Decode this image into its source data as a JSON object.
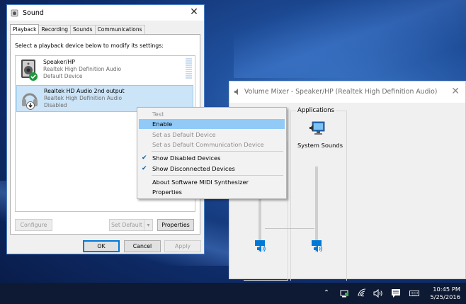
{
  "sound_dialog": {
    "title": "Sound",
    "tabs": [
      "Playback",
      "Recording",
      "Sounds",
      "Communications"
    ],
    "active_tab": "Playback",
    "instructions": "Select a playback device below to modify its settings:",
    "devices": [
      {
        "name": "Speaker/HP",
        "driver": "Realtek High Definition Audio",
        "status": "Default Device",
        "icon": "speaker-icon",
        "badge": "default-check-icon"
      },
      {
        "name": "Realtek HD Audio 2nd output",
        "driver": "Realtek High Definition Audio",
        "status": "Disabled",
        "icon": "headphones-icon",
        "badge": "disabled-arrow-icon"
      }
    ],
    "buttons": {
      "configure": "Configure",
      "set_default": "Set Default",
      "properties": "Properties",
      "ok": "OK",
      "cancel": "Cancel",
      "apply": "Apply"
    }
  },
  "context_menu": {
    "items": [
      {
        "label": "Test",
        "enabled": false
      },
      {
        "label": "Enable",
        "enabled": true,
        "highlighted": true
      },
      {
        "label": "Set as Default Device",
        "enabled": false
      },
      {
        "label": "Set as Default Communication Device",
        "enabled": false
      },
      {
        "label": "Show Disabled Devices",
        "enabled": true,
        "checked": true
      },
      {
        "label": "Show Disconnected Devices",
        "enabled": true,
        "checked": true
      },
      {
        "label": "About Software MIDI Synthesizer",
        "enabled": true
      },
      {
        "label": "Properties",
        "enabled": true
      }
    ]
  },
  "volume_mixer": {
    "title": "Volume Mixer - Speaker/HP (Realtek High Definition Audio)",
    "applications_label": "Applications",
    "apps": [
      {
        "name": "System Sounds",
        "icon": "system-sounds-icon"
      }
    ],
    "device_volume_fraction": 0.1,
    "system_sounds_volume_fraction": 0.1
  },
  "taskbar": {
    "time": "10:45 PM",
    "date": "5/25/2016",
    "tray_icons": [
      "show-hidden-icons-chevron",
      "network-monitor-icon",
      "wifi-icon",
      "volume-icon",
      "action-center-icon",
      "keyboard-icon"
    ]
  },
  "colors": {
    "accent": "#0078d7",
    "selection": "#cce4f7",
    "menu_highlight": "#91c9f7",
    "taskbar": "#0e1a33"
  }
}
